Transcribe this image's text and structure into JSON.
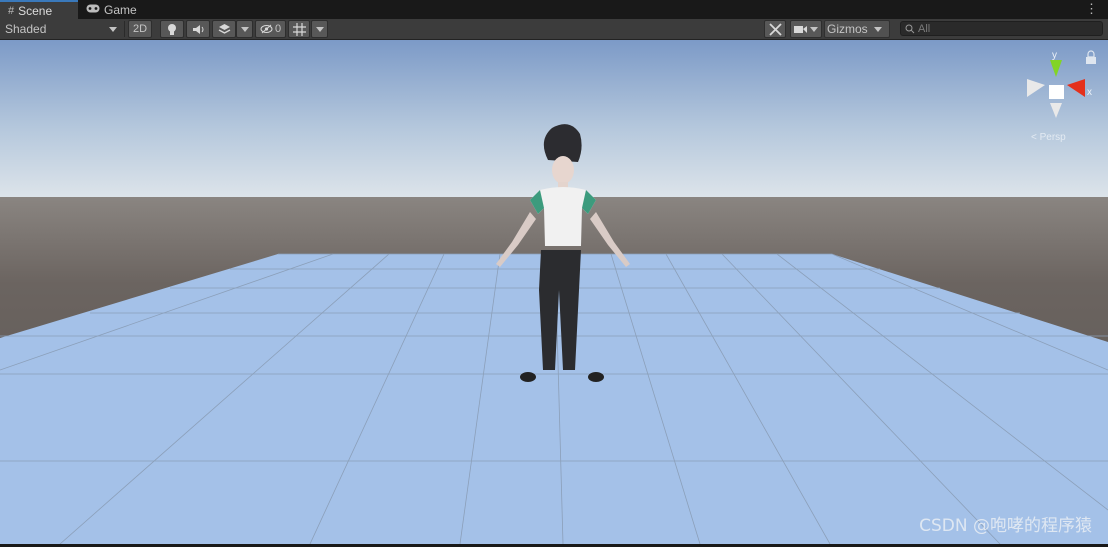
{
  "tabs": [
    {
      "label": "Scene",
      "icon": "grid-icon",
      "active": true
    },
    {
      "label": "Game",
      "icon": "gamepad-icon",
      "active": false
    }
  ],
  "toolbar": {
    "draw_mode": "Shaded",
    "mode_2d_label": "2D",
    "hidden_count": "0",
    "gizmos_label": "Gizmos",
    "search_placeholder": "All"
  },
  "gizmo": {
    "y_label": "y",
    "x_label": "x",
    "projection_label": "< Persp"
  },
  "watermark": "CSDN @咆哮的程序猿",
  "colors": {
    "active_tab_accent": "#3a79bb",
    "gizmo_x": "#e4301c",
    "gizmo_y": "#82d425",
    "floor": "#a4c1e8",
    "horizon": "#6b6460"
  }
}
